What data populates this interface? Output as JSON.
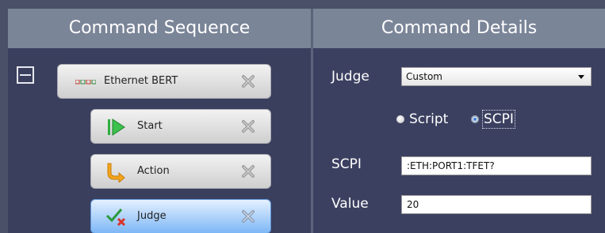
{
  "sequence": {
    "header": "Command Sequence",
    "nodes": [
      {
        "label": "Ethernet BERT",
        "icon": "ethernet-bert-icon"
      },
      {
        "label": "Start",
        "icon": "play-icon"
      },
      {
        "label": "Action",
        "icon": "action-arrow-icon"
      },
      {
        "label": "Judge",
        "icon": "judge-check-icon",
        "selected": true
      }
    ]
  },
  "details": {
    "header": "Command Details",
    "judge_label": "Judge",
    "judge_value": "Custom",
    "radio_script": "Script",
    "radio_scpi": "SCPI",
    "scpi_label": "SCPI",
    "scpi_value": ":ETH:PORT1:TFET?",
    "value_label": "Value",
    "value_value": "20"
  },
  "colors": {
    "header_bg": "#7b8598",
    "panel_bg": "#3a3f5e",
    "selected_node": "#7db7f6"
  }
}
